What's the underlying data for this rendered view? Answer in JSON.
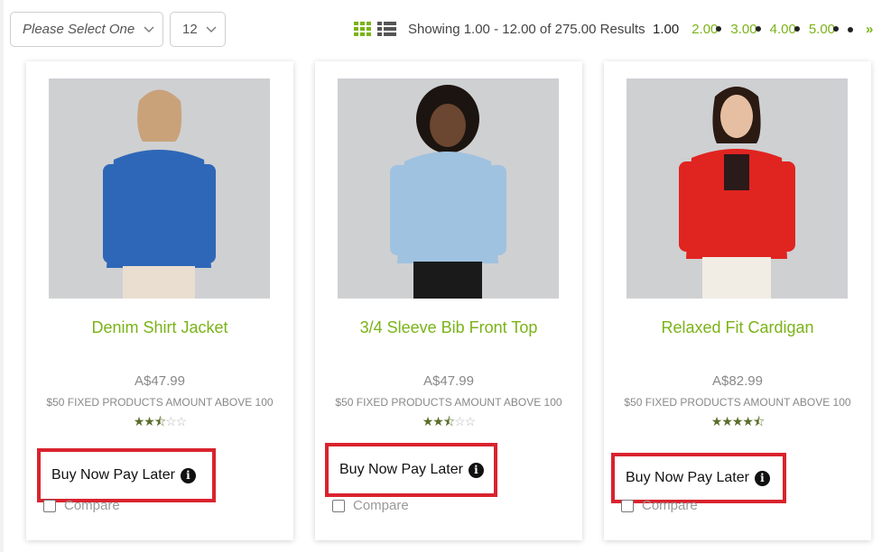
{
  "toolbar": {
    "sort_placeholder": "Please Select One",
    "per_page": "12",
    "results_text": "Showing 1.00 - 12.00 of 275.00 Results",
    "pages": [
      "1.00",
      "2.00",
      "3.00",
      "4.00",
      "5.00"
    ],
    "current_page": "1.00",
    "last_label": "»",
    "icons": {
      "grid": "grid-view-icon",
      "list": "list-view-icon",
      "sort_arrow": "chevron-down-icon"
    }
  },
  "colors": {
    "accent": "#7ab317",
    "highlight_border": "#d9232e",
    "star": "#5a6e2a"
  },
  "products": [
    {
      "name": "Denim Shirt Jacket",
      "price": "A$47.99",
      "promo": "$50 FIXED PRODUCTS AMOUNT ABOVE 100",
      "rating_stars": 2.5,
      "bnpl": "Buy Now Pay Later",
      "compare": "Compare",
      "garment_color": "#2f67b8"
    },
    {
      "name": "3/4 Sleeve Bib Front Top",
      "price": "A$47.99",
      "promo": "$50 FIXED PRODUCTS AMOUNT ABOVE 100",
      "rating_stars": 2.5,
      "bnpl": "Buy Now Pay Later",
      "compare": "Compare",
      "garment_color": "#9fc2e0"
    },
    {
      "name": "Relaxed Fit Cardigan",
      "price": "A$82.99",
      "promo": "$50 FIXED PRODUCTS AMOUNT ABOVE 100",
      "rating_stars": 4.5,
      "bnpl": "Buy Now Pay Later",
      "compare": "Compare",
      "garment_color": "#e02420"
    }
  ]
}
